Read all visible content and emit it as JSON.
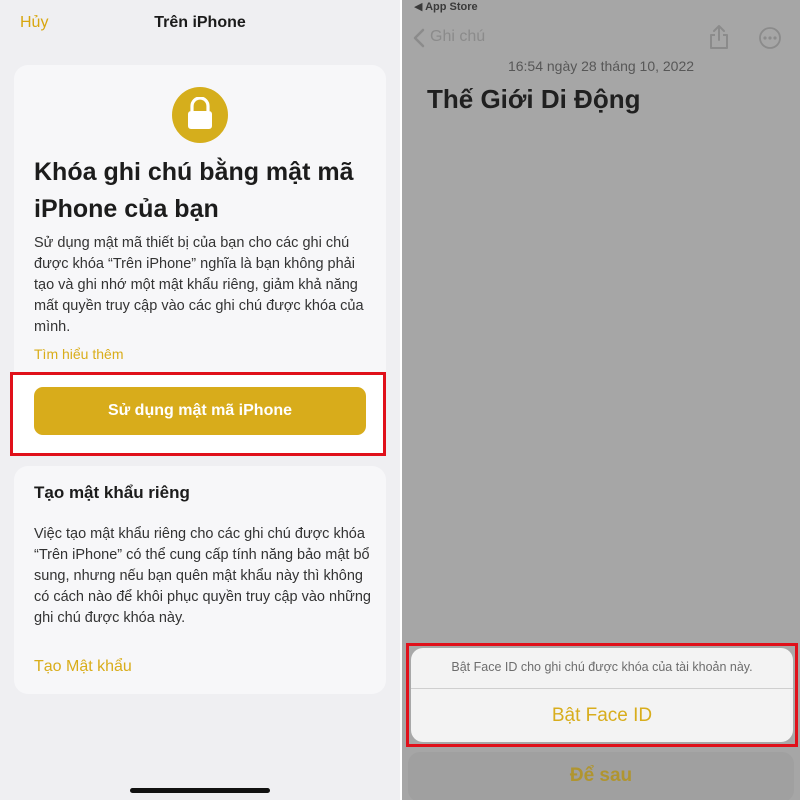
{
  "left": {
    "nav": {
      "cancel": "Hủy",
      "title": "Trên iPhone"
    },
    "card1": {
      "icon": "lock-icon",
      "heading": "Khóa ghi chú bằng mật mã iPhone của bạn",
      "description": "Sử dụng mật mã thiết bị của bạn cho các ghi chú được khóa “Trên iPhone” nghĩa là bạn không phải tạo và ghi nhớ một mật khẩu riêng, giảm khả năng mất quyền truy cập vào các ghi chú được khóa của mình.",
      "learn_more": "Tìm hiểu thêm",
      "primary_button": "Sử dụng mật mã iPhone"
    },
    "card2": {
      "title": "Tạo mật khẩu riêng",
      "description": "Việc tạo mật khẩu riêng cho các ghi chú được khóa “Trên iPhone” có thể cung cấp tính năng bảo mật bổ sung, nhưng nếu bạn quên mật khẩu này thì không có cách nào để khôi phục quyền truy cập vào những ghi chú được khóa này.",
      "link": "Tạo Mật khẩu"
    }
  },
  "right": {
    "status": {
      "back_app": "◀ App Store"
    },
    "nav": {
      "back_label": "Ghi chú",
      "icons": [
        "chevron-left-icon",
        "share-icon",
        "more-icon"
      ]
    },
    "note": {
      "date": "16:54 ngày 28 tháng 10, 2022",
      "title": "Thế Giới Di Động"
    },
    "sheet": {
      "message": "Bật Face ID cho ghi chú được khóa của tài khoản này.",
      "action": "Bật Face ID",
      "later": "Để sau"
    }
  },
  "colors": {
    "accent": "#d8ac1b",
    "highlight": "#e0101a"
  }
}
